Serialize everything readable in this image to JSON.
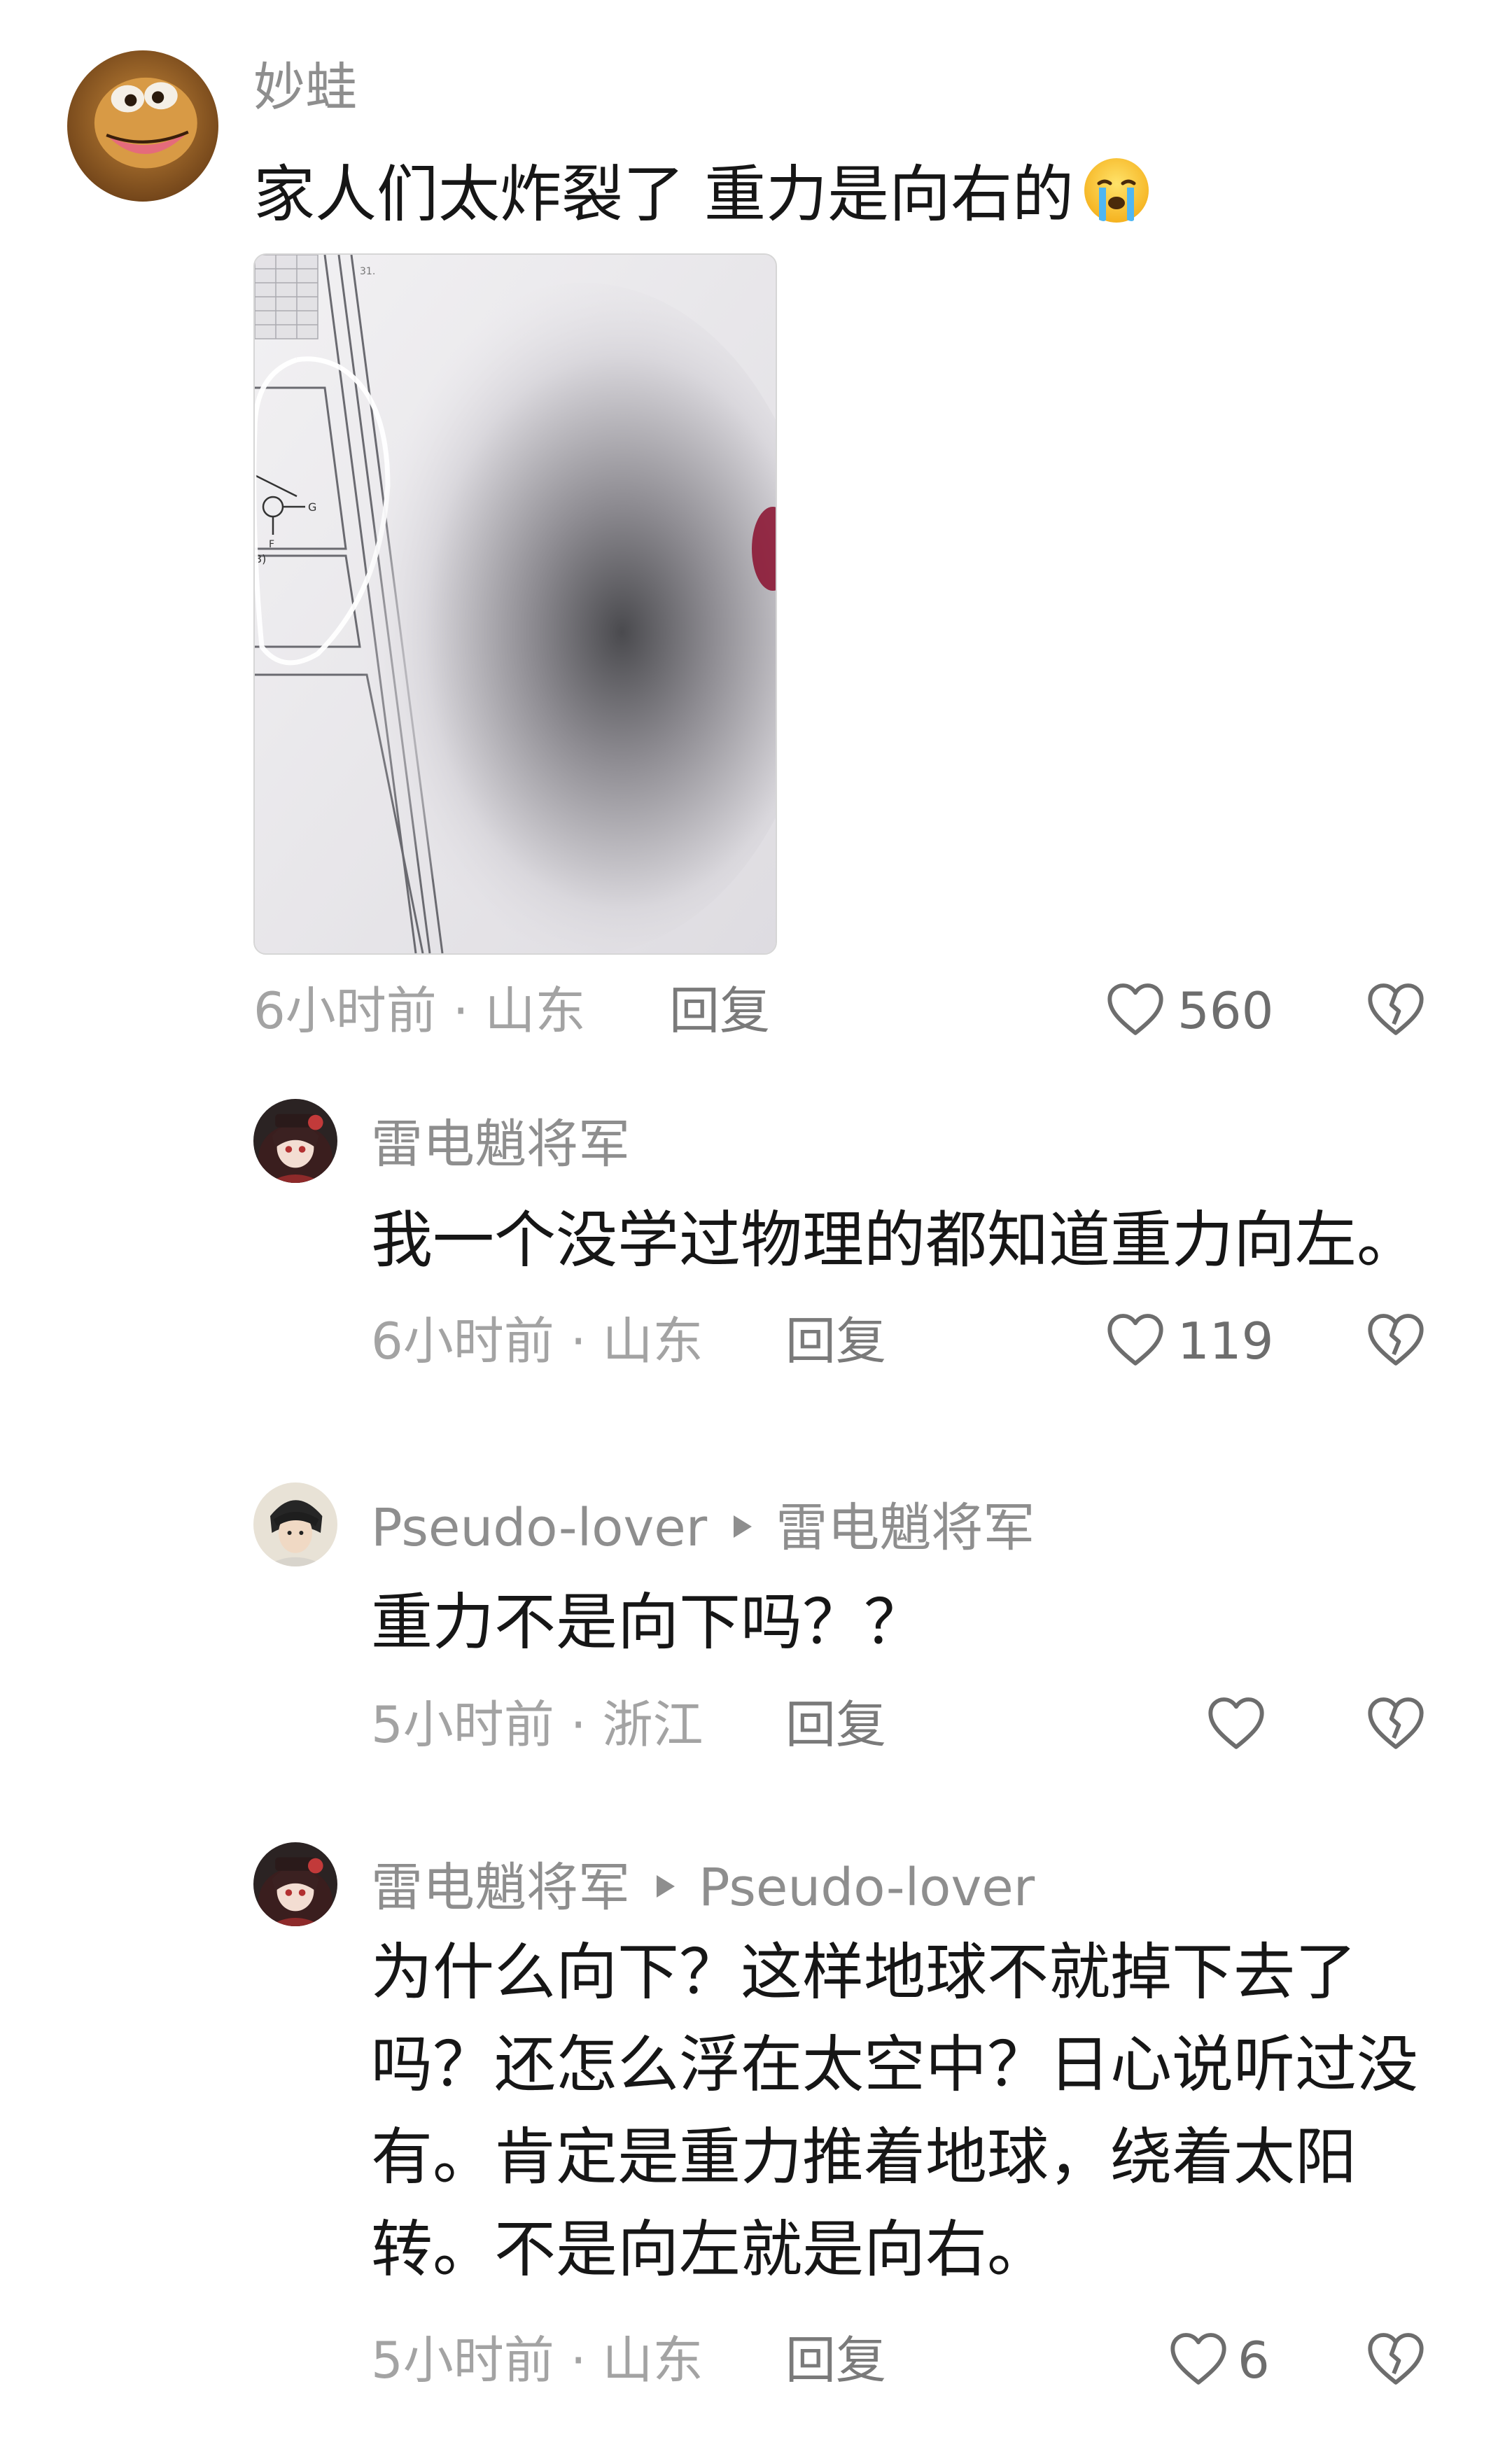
{
  "comments": [
    {
      "username": "妙蛙",
      "text": "家人们太炸裂了 重力是向右的",
      "emoji": "crying-face",
      "time_location": "6小时前 · 山东",
      "reply_label": "回复",
      "likes": "560"
    },
    {
      "username": "雷电魈将军",
      "text": "我一个没学过物理的都知道重力向左。",
      "time_location": "6小时前 · 山东",
      "reply_label": "回复",
      "likes": "119"
    },
    {
      "username": "Pseudo-lover",
      "reply_to": "雷电魈将军",
      "text": "重力不是向下吗？？",
      "time_location": "5小时前 · 浙江",
      "reply_label": "回复",
      "likes": ""
    },
    {
      "username": "雷电魈将军",
      "reply_to": "Pseudo-lover",
      "text_lines": [
        "为什么向下？这样地球不就掉下去了",
        "吗？还怎么浮在太空中？日心说听过没",
        "有。肯定是重力推着地球，绕着太阳",
        "转。不是向左就是向右。"
      ],
      "time_location": "5小时前 · 山东",
      "reply_label": "回复",
      "likes": "6"
    }
  ],
  "colors": {
    "username": "#8e8e8e",
    "body_text": "#161616",
    "meta": "#a3a3a3",
    "icon": "#6d6d6d"
  },
  "icons": [
    "heart-outline-icon",
    "broken-heart-icon",
    "reply-arrow-icon"
  ]
}
